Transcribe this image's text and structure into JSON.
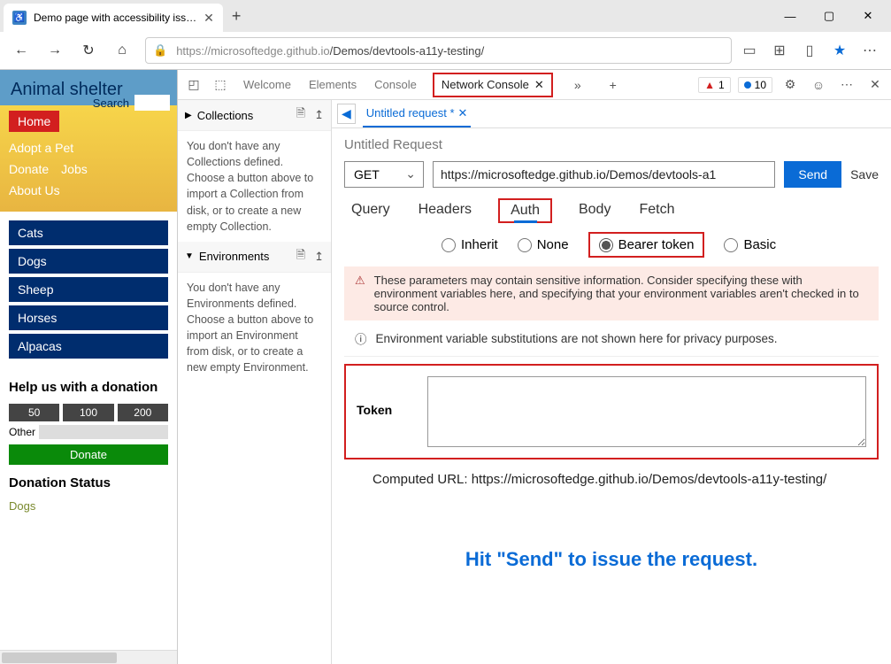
{
  "browser": {
    "tab_title": "Demo page with accessibility iss…",
    "url_prefix": "https://microsoftedge.github.io",
    "url_suffix": "/Demos/devtools-a11y-testing/"
  },
  "site": {
    "title": "Animal shelter",
    "search_label": "Search",
    "nav": {
      "home": "Home",
      "adopt": "Adopt a Pet",
      "donate": "Donate",
      "jobs": "Jobs",
      "about": "About Us"
    },
    "categories": [
      "Cats",
      "Dogs",
      "Sheep",
      "Horses",
      "Alpacas"
    ],
    "help_title": "Help us with a donation",
    "donations": [
      "50",
      "100",
      "200"
    ],
    "other_label": "Other",
    "donate_btn": "Donate",
    "status_title": "Donation Status",
    "status_items": [
      "Dogs"
    ]
  },
  "devtools": {
    "tabs": {
      "welcome": "Welcome",
      "elements": "Elements",
      "console": "Console",
      "network_console": "Network Console"
    },
    "error_count": "1",
    "info_count": "10",
    "collections": {
      "title": "Collections",
      "body": "You don't have any Collections defined. Choose a button above to import a Collection from disk, or to create a new empty Collection.",
      "env_title": "Environments",
      "env_body": "You don't have any Environments defined. Choose a button above to import an Environment from disk, or to create a new empty Environment."
    },
    "request": {
      "tab_label": "Untitled request *",
      "title": "Untitled Request",
      "method": "GET",
      "url": "https://microsoftedge.github.io/Demos/devtools-a1",
      "send": "Send",
      "save": "Save",
      "subtabs": {
        "query": "Query",
        "headers": "Headers",
        "auth": "Auth",
        "body": "Body",
        "fetch": "Fetch"
      },
      "auth_opts": {
        "inherit": "Inherit",
        "none": "None",
        "bearer": "Bearer token",
        "basic": "Basic"
      },
      "warn": "These parameters may contain sensitive information. Consider specifying these with environment variables here, and specifying that your environment variables aren't checked in to source control.",
      "info": "Environment variable substitutions are not shown here for privacy purposes.",
      "token_label": "Token",
      "computed_label": "Computed URL: ",
      "computed_url": "https://microsoftedge.github.io/Demos/devtools-a11y-testing/",
      "send_hint": "Hit \"Send\" to issue the request."
    }
  }
}
